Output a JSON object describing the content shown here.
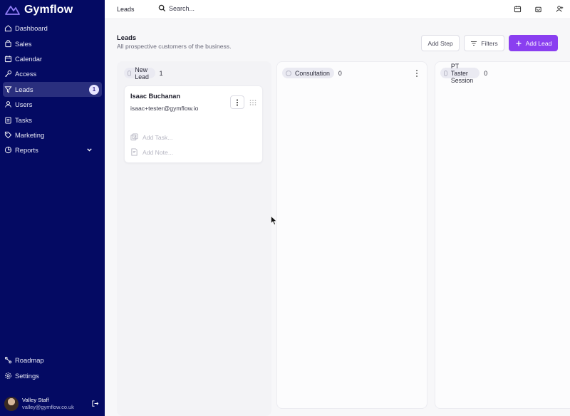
{
  "app": {
    "brand": "Gymflow"
  },
  "sidebar": {
    "items": [
      {
        "label": "Dashboard",
        "icon": "home-icon"
      },
      {
        "label": "Sales",
        "icon": "cart-icon"
      },
      {
        "label": "Calendar",
        "icon": "calendar-icon"
      },
      {
        "label": "Access",
        "icon": "key-icon"
      },
      {
        "label": "Leads",
        "icon": "filter-icon",
        "badge": "1",
        "active": true
      },
      {
        "label": "Users",
        "icon": "users-icon"
      },
      {
        "label": "Tasks",
        "icon": "clipboard-icon"
      },
      {
        "label": "Marketing",
        "icon": "tag-icon"
      },
      {
        "label": "Reports",
        "icon": "chart-icon",
        "expandable": true
      }
    ],
    "bottom": [
      {
        "label": "Roadmap",
        "icon": "roadmap-icon"
      },
      {
        "label": "Settings",
        "icon": "gear-icon"
      }
    ],
    "user": {
      "name": "Valley Staff",
      "email": "valley@gymflow.co.uk"
    }
  },
  "topbar": {
    "breadcrumb": "Leads",
    "search_placeholder": "Search..."
  },
  "page": {
    "title": "Leads",
    "subtitle": "All prospective customers of the business.",
    "buttons": {
      "add_step": "Add Step",
      "filters": "Filters",
      "add_lead": "Add Lead"
    }
  },
  "board": {
    "columns": [
      {
        "name": "New Lead",
        "count": "1"
      },
      {
        "name": "Consultation",
        "count": "0"
      },
      {
        "name": "PT Taster Session",
        "count": "0"
      }
    ],
    "card": {
      "name": "Isaac Buchanan",
      "email": "isaac+tester@gymflow.io",
      "add_task": "Add Task...",
      "add_note": "Add Note..."
    }
  },
  "colors": {
    "sidebar_bg": "#040a63",
    "accent": "#8a3ff0",
    "page_bg": "#f7f7f9"
  }
}
